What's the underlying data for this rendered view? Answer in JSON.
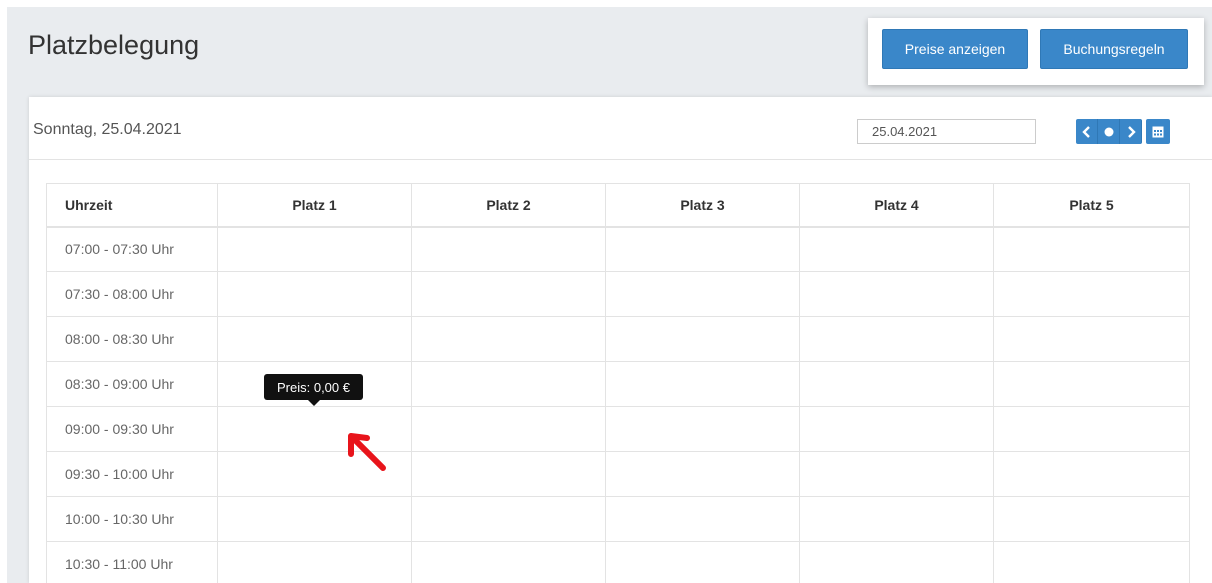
{
  "header": {
    "title": "Platzbelegung",
    "buttons": {
      "prices": "Preise anzeigen",
      "rules": "Buchungsregeln"
    }
  },
  "toolbar": {
    "day_label": "Sonntag, 25.04.2021",
    "date_value": "25.04.2021",
    "nav_icons": [
      "chevron-left-icon",
      "circle-today-icon",
      "chevron-right-icon",
      "calendar-icon"
    ]
  },
  "table": {
    "columns": [
      "Uhrzeit",
      "Platz 1",
      "Platz 2",
      "Platz 3",
      "Platz 4",
      "Platz 5"
    ],
    "rows": [
      "07:00 - 07:30 Uhr",
      "07:30 - 08:00 Uhr",
      "08:00 - 08:30 Uhr",
      "08:30 - 09:00 Uhr",
      "09:00 - 09:30 Uhr",
      "09:30 - 10:00 Uhr",
      "10:00 - 10:30 Uhr",
      "10:30 - 11:00 Uhr"
    ]
  },
  "tooltip": {
    "text": "Preis: 0,00 €"
  },
  "colors": {
    "accent": "#3a87c9",
    "annotation": "#e8141b"
  }
}
